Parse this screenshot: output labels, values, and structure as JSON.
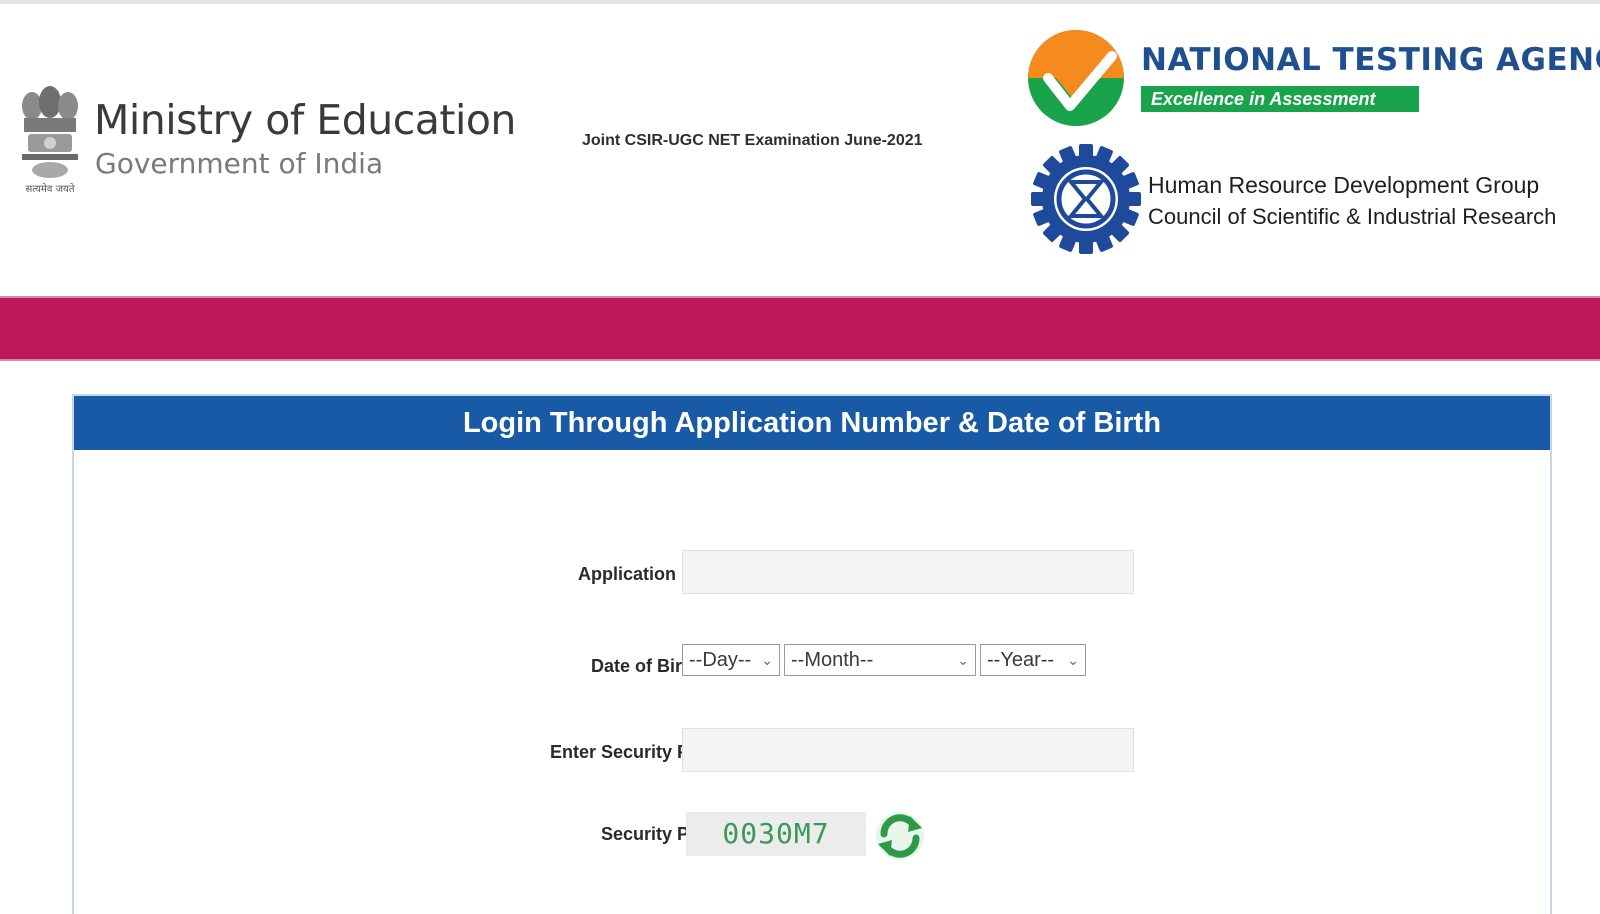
{
  "header": {
    "emblem_caption": "सत्यमेव जयते",
    "ministry_name": "Ministry of Education",
    "government_name": "Government of India",
    "exam_title": "Joint CSIR-UGC NET Examination June-2021",
    "nta_name": "NATIONAL TESTING AGENCY",
    "nta_tagline": "Excellence in Assessment",
    "hrdg_name": "Human Resource Development Group",
    "csir_name": "Council of Scientific & Industrial Research"
  },
  "colors": {
    "banner": "#bf1858",
    "card_header": "#195aa6",
    "nta_blue": "#1f4f8f",
    "nta_green": "#19a34a",
    "nta_orange": "#f58a1f",
    "csir_blue": "#1f4a9c",
    "captcha_text": "#3a9a5a"
  },
  "login": {
    "title": "Login Through Application Number & Date of Birth",
    "application_label": "Application No :",
    "application_value": "",
    "dob_label": "Date of Birth :",
    "day_selected": "--Day--",
    "month_selected": "--Month--",
    "year_selected": "--Year--",
    "security_input_label": "Enter Security Pin :",
    "security_input_value": "",
    "security_pin_label": "Security Pin :",
    "captcha_code": "0030M7",
    "refresh_icon": "refresh-icon"
  }
}
